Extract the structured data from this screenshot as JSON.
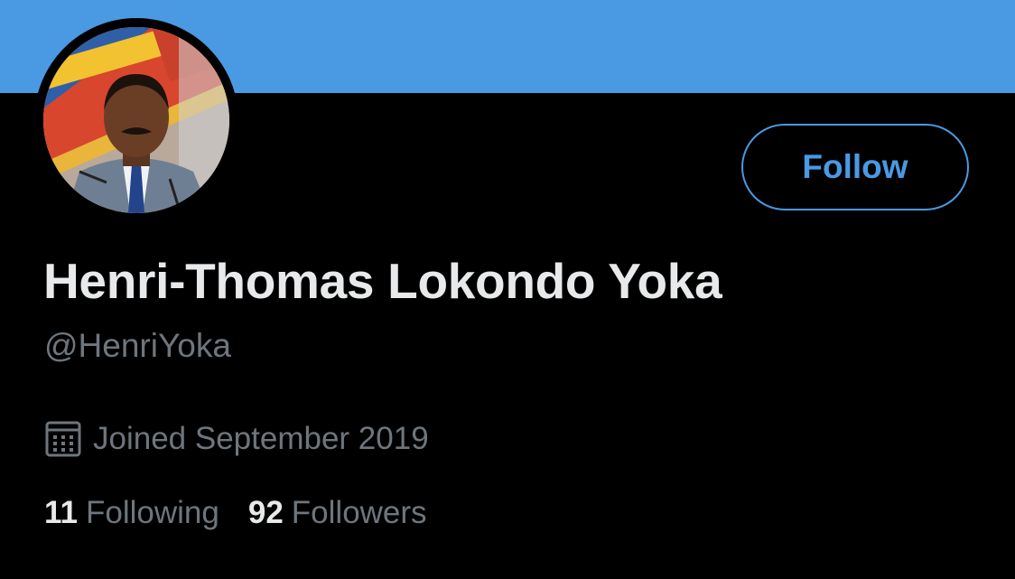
{
  "colors": {
    "banner": "#4a99e3",
    "background": "#000000",
    "accent": "#4a99e3",
    "primary_text": "#e7e9ea",
    "secondary_text": "#6e767d"
  },
  "profile": {
    "display_name": "Henri-Thomas Lokondo Yoka",
    "handle": "@HenriYoka",
    "joined": "Joined September 2019",
    "joined_icon": "calendar-icon"
  },
  "actions": {
    "follow_label": "Follow"
  },
  "stats": {
    "following_count": "11",
    "following_label": "Following",
    "followers_count": "92",
    "followers_label": "Followers"
  }
}
